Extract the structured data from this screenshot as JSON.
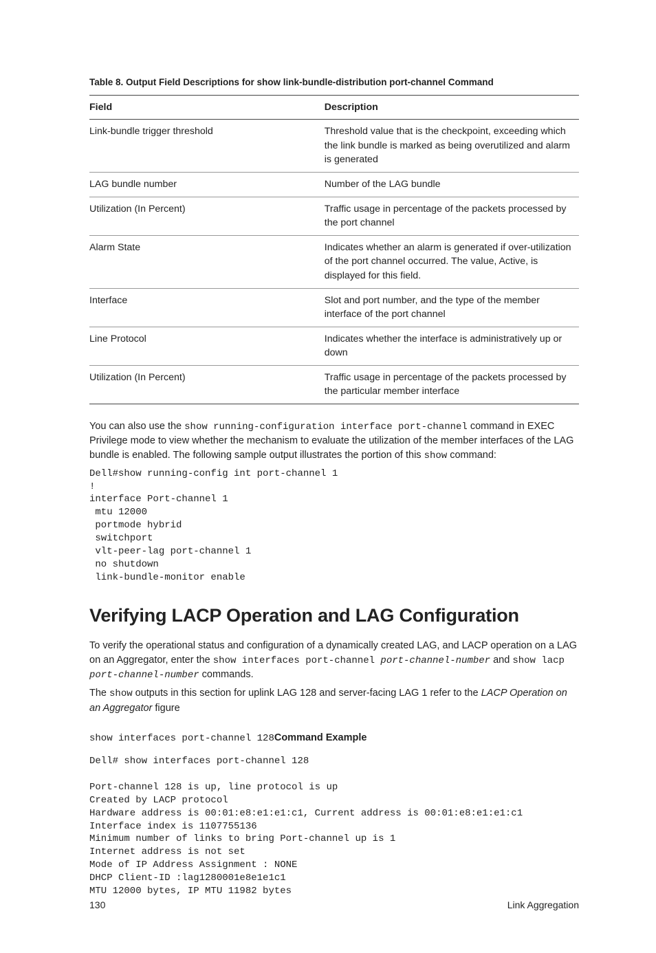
{
  "table": {
    "caption": "Table 8. Output Field Descriptions for show link-bundle-distribution port-channel Command",
    "headers": [
      "Field",
      "Description"
    ],
    "rows": [
      {
        "field": "Link-bundle trigger threshold",
        "desc": "Threshold value that is the checkpoint, exceeding which the link bundle is marked as being overutilized and alarm is generated"
      },
      {
        "field": "LAG bundle number",
        "desc": "Number of the LAG bundle"
      },
      {
        "field": "Utilization (In Percent)",
        "desc": "Traffic usage in percentage of the packets processed by the port channel"
      },
      {
        "field": "Alarm State",
        "desc": "Indicates whether an alarm is generated if over-utilization of the port channel occurred. The value, Active, is displayed for this field."
      },
      {
        "field": "Interface",
        "desc": "Slot and port number, and the type of the member interface of the port channel"
      },
      {
        "field": "Line Protocol",
        "desc": "Indicates whether the interface is administratively up or down"
      },
      {
        "field": "Utilization (In Percent)",
        "desc": "Traffic usage in percentage of the packets processed by the particular member interface"
      }
    ]
  },
  "para1": {
    "t1": "You can also use the ",
    "cmd": "show running-configuration interface port-channel",
    "t2": " command in EXEC Privilege mode to view whether the mechanism to evaluate the utilization of the member interfaces of the LAG bundle is enabled. The following sample output illustrates the portion of this ",
    "cmd2": "show",
    "t3": " command:"
  },
  "code1": "Dell#show running-config int port-channel 1\n!\ninterface Port-channel 1\n mtu 12000\n portmode hybrid\n switchport\n vlt-peer-lag port-channel 1\n no shutdown\n link-bundle-monitor enable",
  "heading": "Verifying LACP Operation and LAG Configuration",
  "para2": {
    "t1": "To verify the operational status and configuration of a dynamically created LAG, and LACP operation on a LAG on an Aggregator, enter the ",
    "cmd1": "show interfaces port-channel ",
    "arg1": "port-channel-number",
    "t2": " and ",
    "cmd2": "show lacp ",
    "arg2": "port-channel-number",
    "t3": " commands."
  },
  "para3": {
    "t1": "The ",
    "cmd": "show",
    "t2": " outputs in this section for uplink LAG 128 and server-facing LAG 1 refer to the ",
    "italic": "LACP Operation on an Aggregator",
    "t3": " figure"
  },
  "example": {
    "cmd": "show interfaces port-channel 128",
    "label": "Command Example"
  },
  "code2": "Dell# show interfaces port-channel 128\n\nPort-channel 128 is up, line protocol is up\nCreated by LACP protocol\nHardware address is 00:01:e8:e1:e1:c1, Current address is 00:01:e8:e1:e1:c1\nInterface index is 1107755136\nMinimum number of links to bring Port-channel up is 1\nInternet address is not set\nMode of IP Address Assignment : NONE\nDHCP Client-ID :lag1280001e8e1e1c1\nMTU 12000 bytes, IP MTU 11982 bytes",
  "footer": {
    "page": "130",
    "section": "Link Aggregation"
  }
}
